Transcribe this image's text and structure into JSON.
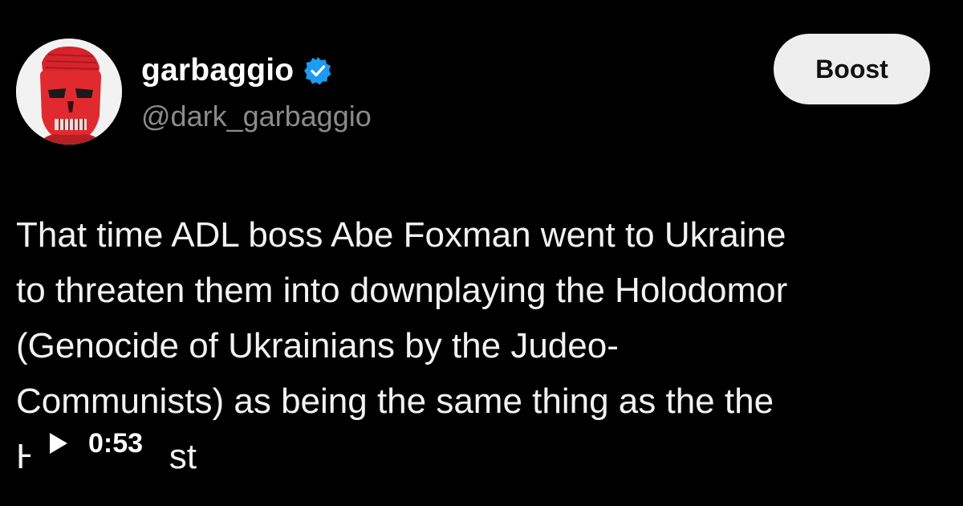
{
  "author": {
    "display_name": "garbaggio",
    "handle": "@dark_garbaggio",
    "verified": true,
    "avatar_icon": "red-skull-face-icon"
  },
  "actions": {
    "boost_label": "Boost"
  },
  "post": {
    "lines": [
      "That time ADL boss Abe Foxman went to Ukraine",
      "to threaten them into downplaying the Holodomor",
      "(Genocide of Ukrainians by the Judeo-",
      "Communists) as being the same thing as the the",
      "H             st"
    ]
  },
  "video": {
    "duration": "0:53",
    "play_icon": "play-icon"
  },
  "colors": {
    "background": "#000000",
    "text": "#f2f2f2",
    "handle": "#8b8b8b",
    "verified": "#1d9bf0",
    "button_bg": "#eeeeee"
  }
}
